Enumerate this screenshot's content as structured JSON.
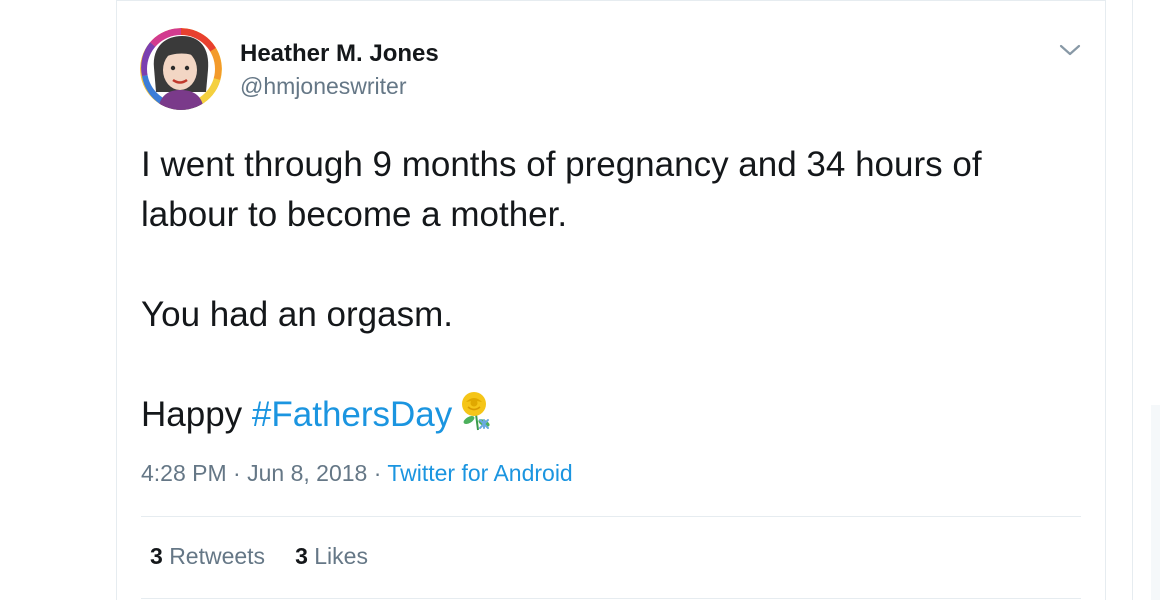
{
  "tweet": {
    "author": {
      "display_name": "Heather M. Jones",
      "handle": "@hmjoneswriter"
    },
    "text": {
      "line1": "I went through 9 months of pregnancy and 34 hours of",
      "line2": "labour to become a mother.",
      "line3": "You had an orgasm.",
      "line4_prefix": "Happy ",
      "hashtag": "#FathersDay"
    },
    "meta": {
      "time": "4:28 PM",
      "separator1": " · ",
      "date": "Jun 8, 2018",
      "separator2": " · ",
      "source": "Twitter for Android"
    },
    "stats": {
      "retweets_count": "3",
      "retweets_label": "Retweets",
      "likes_count": "3",
      "likes_label": "Likes"
    }
  },
  "icons": {
    "caret": "chevron-down-icon",
    "emoji": "yellow-rose-emoji"
  },
  "colors": {
    "link": "#1b95e0",
    "text": "#14171a",
    "secondary": "#657786",
    "border": "#e6ecf0"
  }
}
